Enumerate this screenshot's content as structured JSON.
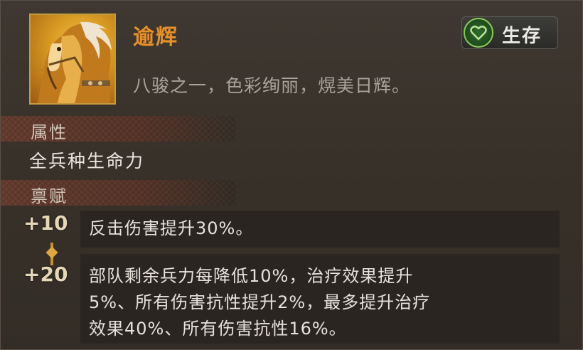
{
  "item": {
    "name": "逾辉",
    "description": "八骏之一，色彩绚丽，熀美日辉。",
    "badge_label": "生存"
  },
  "sections": {
    "attribute_title": "属性",
    "attribute_value": "全兵种生命力",
    "talent_title": "禀赋"
  },
  "talents": [
    {
      "level": "+10",
      "text": "反击伤害提升30%。"
    },
    {
      "level": "+20",
      "lines": [
        "部队剩余兵力每降低10%，治疗效果提升",
        "5%、所有伤害抗性提升2%，最多提升治疗",
        "效果40%、所有伤害抗性16%。"
      ]
    }
  ],
  "colors": {
    "name": "#e8902a",
    "badge_icon": "#8acb5a",
    "section_bar": "#6a3f31",
    "level_link": "#c99030"
  },
  "icons": {
    "badge": "heart-icon",
    "portrait": "horse-portrait"
  }
}
